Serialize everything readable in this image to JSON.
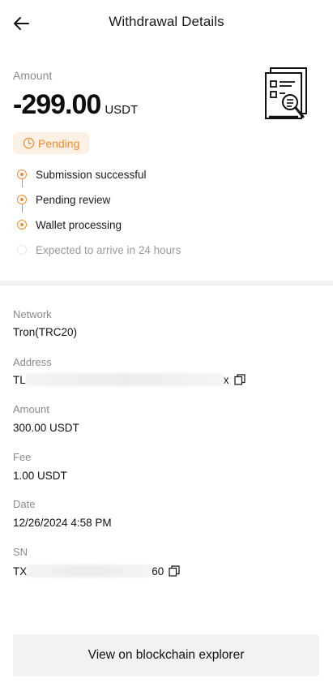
{
  "header": {
    "title": "Withdrawal Details"
  },
  "summary": {
    "amount_label": "Amount",
    "amount_value": "-299.00",
    "amount_unit": "USDT",
    "status": "Pending",
    "status_color": "#f28b2c"
  },
  "timeline": {
    "steps": [
      {
        "label": "Submission successful",
        "done": true
      },
      {
        "label": "Pending review",
        "done": true
      },
      {
        "label": "Wallet processing",
        "done": true
      },
      {
        "label": "Expected to arrive in 24 hours",
        "done": false
      }
    ]
  },
  "details": {
    "network_label": "Network",
    "network_value": "Tron(TRC20)",
    "address_label": "Address",
    "address_prefix": "TL",
    "address_suffix": "x",
    "amount_label": "Amount",
    "amount_value": "300.00 USDT",
    "fee_label": "Fee",
    "fee_value": "1.00 USDT",
    "date_label": "Date",
    "date_value": "12/26/2024 4:58 PM",
    "sn_label": "SN",
    "sn_prefix": "TX",
    "sn_suffix": "60"
  },
  "actions": {
    "explorer_label": "View on blockchain explorer"
  },
  "icons": {
    "back": "arrow-left-icon",
    "clock": "clock-icon",
    "document": "document-search-icon",
    "copy": "copy-icon"
  }
}
